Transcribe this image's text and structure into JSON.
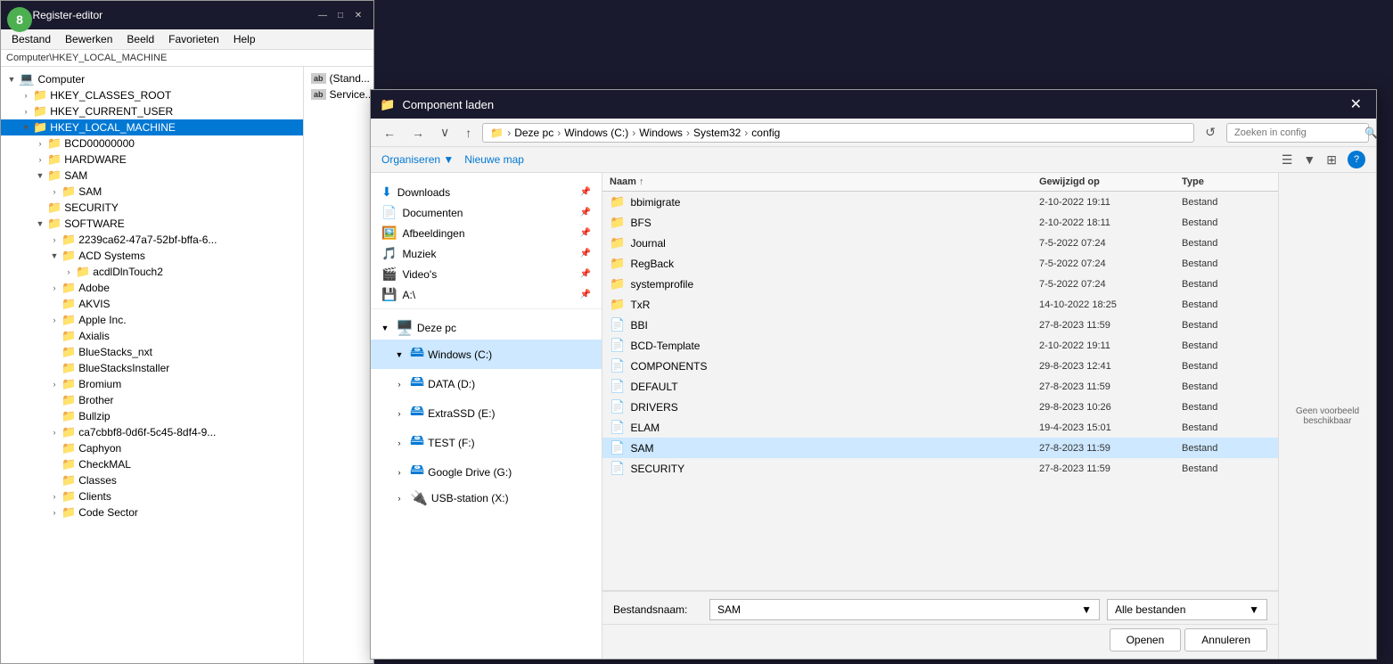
{
  "stepBadge": "8",
  "registryWindow": {
    "title": "Register-editor",
    "titlebarIcon": "📋",
    "menuItems": [
      "Bestand",
      "Bewerken",
      "Beeld",
      "Favorieten",
      "Help"
    ],
    "addressPath": "Computer\\HKEY_LOCAL_MACHINE",
    "tree": [
      {
        "label": "Computer",
        "indent": 0,
        "expanded": true,
        "type": "computer",
        "icon": "💻"
      },
      {
        "label": "HKEY_CLASSES_ROOT",
        "indent": 1,
        "expanded": false,
        "type": "folder"
      },
      {
        "label": "HKEY_CURRENT_USER",
        "indent": 1,
        "expanded": false,
        "type": "folder"
      },
      {
        "label": "HKEY_LOCAL_MACHINE",
        "indent": 1,
        "expanded": true,
        "type": "folder",
        "selected": true
      },
      {
        "label": "BCD00000000",
        "indent": 2,
        "expanded": false,
        "type": "folder"
      },
      {
        "label": "HARDWARE",
        "indent": 2,
        "expanded": false,
        "type": "folder"
      },
      {
        "label": "SAM",
        "indent": 2,
        "expanded": true,
        "type": "folder"
      },
      {
        "label": "SAM",
        "indent": 3,
        "expanded": false,
        "type": "folder"
      },
      {
        "label": "SECURITY",
        "indent": 2,
        "expanded": false,
        "type": "folder"
      },
      {
        "label": "SOFTWARE",
        "indent": 2,
        "expanded": true,
        "type": "folder"
      },
      {
        "label": "2239ca62-47a7-52bf-bffa-6...",
        "indent": 3,
        "expanded": false,
        "type": "folder"
      },
      {
        "label": "ACD Systems",
        "indent": 3,
        "expanded": true,
        "type": "folder"
      },
      {
        "label": "acdlDlnTouch2",
        "indent": 4,
        "expanded": false,
        "type": "folder"
      },
      {
        "label": "Adobe",
        "indent": 3,
        "expanded": false,
        "type": "folder"
      },
      {
        "label": "AKVIS",
        "indent": 3,
        "expanded": false,
        "type": "folder"
      },
      {
        "label": "Apple Inc.",
        "indent": 3,
        "expanded": false,
        "type": "folder"
      },
      {
        "label": "Axialis",
        "indent": 3,
        "expanded": false,
        "type": "folder"
      },
      {
        "label": "BlueStacks_nxt",
        "indent": 3,
        "expanded": false,
        "type": "folder"
      },
      {
        "label": "BlueStacksInstaller",
        "indent": 3,
        "expanded": false,
        "type": "folder"
      },
      {
        "label": "Bromium",
        "indent": 3,
        "expanded": false,
        "type": "folder"
      },
      {
        "label": "Brother",
        "indent": 3,
        "expanded": false,
        "type": "folder"
      },
      {
        "label": "Bullzip",
        "indent": 3,
        "expanded": false,
        "type": "folder"
      },
      {
        "label": "ca7cbbf8-0d6f-5c45-8df4-9...",
        "indent": 3,
        "expanded": false,
        "type": "folder"
      },
      {
        "label": "Caphyon",
        "indent": 3,
        "expanded": false,
        "type": "folder"
      },
      {
        "label": "CheckMAL",
        "indent": 3,
        "expanded": false,
        "type": "folder"
      },
      {
        "label": "Classes",
        "indent": 3,
        "expanded": false,
        "type": "folder"
      },
      {
        "label": "Clients",
        "indent": 3,
        "expanded": false,
        "type": "folder"
      },
      {
        "label": "Code Sector",
        "indent": 3,
        "expanded": false,
        "type": "folder"
      }
    ],
    "values": [
      {
        "icon": "ab",
        "name": "(Stand..."
      },
      {
        "icon": "ab",
        "name": "Service..."
      }
    ]
  },
  "dialog": {
    "title": "Component laden",
    "titleIcon": "📁",
    "nav": {
      "backLabel": "←",
      "forwardLabel": "→",
      "dropdownLabel": "∨",
      "upLabel": "↑",
      "refreshLabel": "↺",
      "addressParts": [
        "Deze pc",
        "Windows (C:)",
        "Windows",
        "System32",
        "config"
      ],
      "searchPlaceholder": "Zoeken in config"
    },
    "toolbar": {
      "organizeLabel": "Organiseren ▼",
      "newFolderLabel": "Nieuwe map"
    },
    "navPanel": {
      "pinned": [
        {
          "label": "Downloads",
          "icon": "⬇️"
        },
        {
          "label": "Documenten",
          "icon": "📄"
        },
        {
          "label": "Afbeeldingen",
          "icon": "🖼️"
        },
        {
          "label": "Muziek",
          "icon": "🎵"
        },
        {
          "label": "Video's",
          "icon": "🎬"
        },
        {
          "label": "A:\\",
          "icon": "💾"
        }
      ],
      "drives": [
        {
          "label": "Deze pc",
          "expanded": true,
          "type": "pc"
        },
        {
          "label": "Windows  (C:)",
          "expanded": true,
          "selected": true,
          "type": "windows",
          "indent": 1
        },
        {
          "label": "DATA (D:)",
          "expanded": false,
          "type": "drive",
          "indent": 1
        },
        {
          "label": "ExtraSSD (E:)",
          "expanded": false,
          "type": "drive",
          "indent": 1
        },
        {
          "label": "TEST (F:)",
          "expanded": false,
          "type": "drive",
          "indent": 1
        },
        {
          "label": "Google Drive (G:)",
          "expanded": false,
          "type": "drive",
          "indent": 1
        },
        {
          "label": "USB-station (X:)",
          "expanded": false,
          "type": "usb",
          "indent": 1
        }
      ]
    },
    "fileList": {
      "columns": [
        "Naam",
        "Gewijzigd op",
        "Type"
      ],
      "sortIndicator": "↑",
      "files": [
        {
          "name": "bbimigrate",
          "date": "2-10-2022 19:11",
          "type": "Bestand",
          "isFolder": true
        },
        {
          "name": "BFS",
          "date": "2-10-2022 18:11",
          "type": "Bestand",
          "isFolder": true
        },
        {
          "name": "Journal",
          "date": "7-5-2022 07:24",
          "type": "Bestand",
          "isFolder": true
        },
        {
          "name": "RegBack",
          "date": "7-5-2022 07:24",
          "type": "Bestand",
          "isFolder": true
        },
        {
          "name": "systemprofile",
          "date": "7-5-2022 07:24",
          "type": "Bestand",
          "isFolder": true
        },
        {
          "name": "TxR",
          "date": "14-10-2022 18:25",
          "type": "Bestand",
          "isFolder": true
        },
        {
          "name": "BBI",
          "date": "27-8-2023 11:59",
          "type": "Bestand",
          "isFolder": false
        },
        {
          "name": "BCD-Template",
          "date": "2-10-2022 19:11",
          "type": "Bestand",
          "isFolder": false
        },
        {
          "name": "COMPONENTS",
          "date": "29-8-2023 12:41",
          "type": "Bestand",
          "isFolder": false
        },
        {
          "name": "DEFAULT",
          "date": "27-8-2023 11:59",
          "type": "Bestand",
          "isFolder": false
        },
        {
          "name": "DRIVERS",
          "date": "29-8-2023 10:26",
          "type": "Bestand",
          "isFolder": false
        },
        {
          "name": "ELAM",
          "date": "19-4-2023 15:01",
          "type": "Bestand",
          "isFolder": false
        },
        {
          "name": "SAM",
          "date": "27-8-2023 11:59",
          "type": "Bestand",
          "isFolder": false,
          "selected": true
        },
        {
          "name": "SECURITY",
          "date": "27-8-2023 11:59",
          "type": "Bestand",
          "isFolder": false
        }
      ]
    },
    "preview": {
      "text": "Geen voorbeeld beschikbaar"
    },
    "bottomBar": {
      "filenameLabelText": "Bestandsnaam:",
      "filenameValue": "SAM",
      "filetypeValue": "Alle bestanden",
      "openBtn": "Openen",
      "cancelBtn": "Annuleren"
    }
  }
}
